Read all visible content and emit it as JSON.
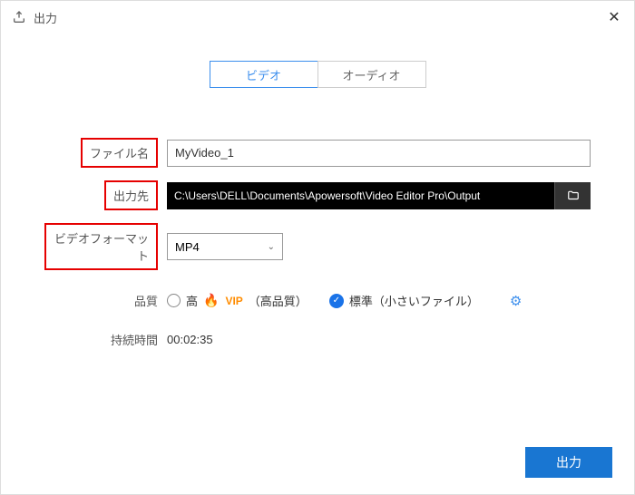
{
  "window": {
    "title": "出力"
  },
  "tabs": {
    "video": "ビデオ",
    "audio": "オーディオ"
  },
  "labels": {
    "filename": "ファイル名",
    "output_dir": "出力先",
    "video_format": "ビデオフォーマット",
    "quality": "品質",
    "duration": "持続時間"
  },
  "values": {
    "filename": "MyVideo_1",
    "output_dir": "C:\\Users\\DELL\\Documents\\Apowersoft\\Video Editor Pro\\Output",
    "format": "MP4",
    "duration": "00:02:35"
  },
  "quality": {
    "high": "高",
    "vip": "VIP",
    "high_suffix": "（高品質）",
    "standard": "標準（小さいファイル）"
  },
  "buttons": {
    "export": "出力"
  }
}
